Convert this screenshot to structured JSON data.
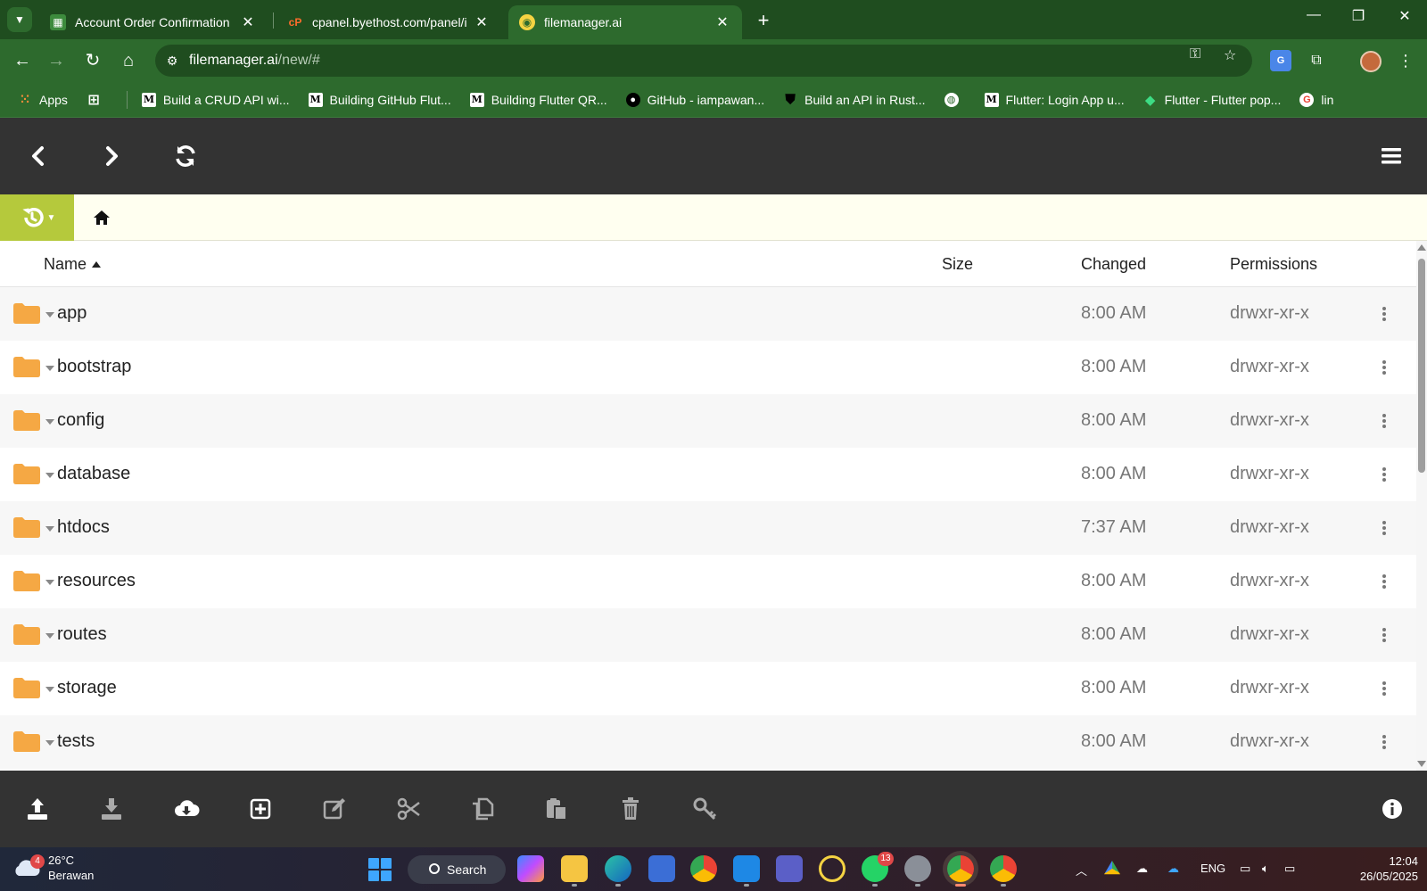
{
  "browser": {
    "tabs": [
      {
        "title": "Account Order Confirmation",
        "active": false
      },
      {
        "title": "cpanel.byethost.com/panel/index.php",
        "active": false
      },
      {
        "title": "filemanager.ai",
        "active": true
      }
    ],
    "url_host": "filemanager.ai",
    "url_path": "/new/#",
    "bookmarks": [
      {
        "label": "Apps",
        "icon": "apps-grid-icon"
      },
      {
        "label": "Build a CRUD API wi...",
        "icon": "medium-icon"
      },
      {
        "label": "Building GitHub Flut...",
        "icon": "medium-icon"
      },
      {
        "label": "Building Flutter QR...",
        "icon": "medium-icon"
      },
      {
        "label": "GitHub - iampawan...",
        "icon": "github-icon"
      },
      {
        "label": "Build an API in Rust...",
        "icon": "shield-icon"
      },
      {
        "label": "",
        "icon": "globe-icon"
      },
      {
        "label": "Flutter: Login App u...",
        "icon": "medium-icon"
      },
      {
        "label": "Flutter - Flutter pop...",
        "icon": "flutter-diamond-icon"
      },
      {
        "label": "lin",
        "icon": "google-icon"
      }
    ]
  },
  "file_manager": {
    "columns": {
      "name": "Name",
      "size": "Size",
      "changed": "Changed",
      "permissions": "Permissions"
    },
    "sort": {
      "column": "Name",
      "direction": "ascending"
    },
    "rows": [
      {
        "name": "app",
        "size": "",
        "changed": "8:00 AM",
        "permissions": "drwxr-xr-x"
      },
      {
        "name": "bootstrap",
        "size": "",
        "changed": "8:00 AM",
        "permissions": "drwxr-xr-x"
      },
      {
        "name": "config",
        "size": "",
        "changed": "8:00 AM",
        "permissions": "drwxr-xr-x"
      },
      {
        "name": "database",
        "size": "",
        "changed": "8:00 AM",
        "permissions": "drwxr-xr-x"
      },
      {
        "name": "htdocs",
        "size": "",
        "changed": "7:37 AM",
        "permissions": "drwxr-xr-x"
      },
      {
        "name": "resources",
        "size": "",
        "changed": "8:00 AM",
        "permissions": "drwxr-xr-x"
      },
      {
        "name": "routes",
        "size": "",
        "changed": "8:00 AM",
        "permissions": "drwxr-xr-x"
      },
      {
        "name": "storage",
        "size": "",
        "changed": "8:00 AM",
        "permissions": "drwxr-xr-x"
      },
      {
        "name": "tests",
        "size": "",
        "changed": "8:00 AM",
        "permissions": "drwxr-xr-x"
      }
    ],
    "colors": {
      "topbar": "#333333",
      "history_button": "#b5c93c",
      "pathbar": "#fffff0",
      "folder": "#f5a844"
    }
  },
  "taskbar": {
    "weather": {
      "temp": "26°C",
      "condition": "Berawan",
      "badge": "4"
    },
    "search_label": "Search",
    "whatsapp_badge": "13",
    "language": "ENG",
    "time": "12:04",
    "date": "26/05/2025"
  }
}
